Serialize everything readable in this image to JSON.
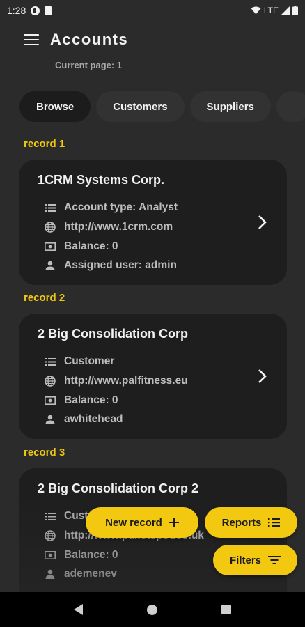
{
  "status_bar": {
    "time": "1:28",
    "network": "LTE"
  },
  "header": {
    "title": "Accounts",
    "subtitle": "Current page: 1"
  },
  "tabs": [
    {
      "label": "Browse"
    },
    {
      "label": "Customers"
    },
    {
      "label": "Suppliers"
    },
    {
      "label": ""
    }
  ],
  "records": [
    {
      "label": "record 1",
      "name": "1CRM Systems Corp.",
      "type": "Account type: Analyst",
      "website": "http://www.1crm.com",
      "balance": "Balance: 0",
      "user": "Assigned user: admin"
    },
    {
      "label": "record 2",
      "name": "2 Big Consolidation Corp",
      "type": "Customer",
      "website": "http://www.palfitness.eu",
      "balance": "Balance: 0",
      "user": "awhitehead"
    },
    {
      "label": "record 3",
      "name": "2 Big Consolidation Corp 2",
      "type": "Customer",
      "website": "http://www.palletspot.co.uk",
      "balance": "Balance: 0",
      "user": "ademenev"
    }
  ],
  "fabs": {
    "new_record": "New record",
    "reports": "Reports",
    "filters": "Filters"
  },
  "colors": {
    "accent": "#f2c811",
    "background": "#2b2b2b",
    "card": "#1e1e1e"
  }
}
